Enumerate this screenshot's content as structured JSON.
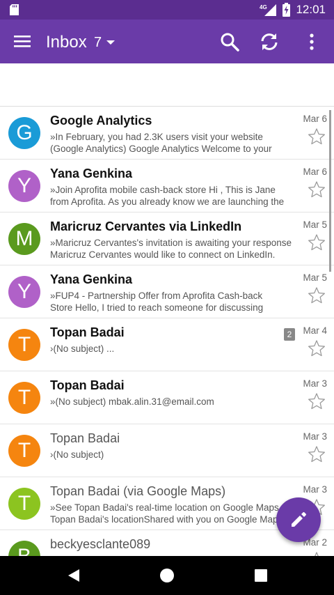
{
  "status_bar": {
    "network": "4G",
    "time": "12:01"
  },
  "app_bar": {
    "title": "Inbox",
    "unread_count": "7"
  },
  "emails": [
    {
      "sender": "Google Analytics",
      "bold": true,
      "initial": "G",
      "avatar_color": "#1a9bd7",
      "date": "Mar 6",
      "count": "",
      "line1": "»In February, you had 2.3K users visit your website",
      "line2": "(Google Analytics) Google Analytics Welcome to your"
    },
    {
      "sender": "Yana Genkina",
      "bold": true,
      "initial": "Y",
      "avatar_color": "#b061c8",
      "date": "Mar 6",
      "count": "",
      "line1": "»Join Aprofita mobile cash-back store Hi , This is Jane",
      "line2": "from Aprofita. As you already know we are launching the"
    },
    {
      "sender": "Maricruz Cervantes via LinkedIn",
      "bold": true,
      "initial": "M",
      "avatar_color": "#5a9a1e",
      "date": "Mar 5",
      "count": "",
      "line1": "»Maricruz Cervantes's invitation is awaiting your response",
      "line2": "Maricruz Cervantes would like to connect on LinkedIn."
    },
    {
      "sender": "Yana Genkina",
      "bold": true,
      "initial": "Y",
      "avatar_color": "#b061c8",
      "date": "Mar 5",
      "count": "",
      "line1": "»FUP4 - Partnership Offer from Aprofita Cash-back",
      "line2": "Store Hello, I tried to reach someone for discussing"
    },
    {
      "sender": "Topan Badai",
      "bold": true,
      "initial": "T",
      "avatar_color": "#f5850f",
      "date": "Mar 4",
      "count": "2",
      "line1": "›(No subject) ...",
      "line2": ""
    },
    {
      "sender": "Topan Badai",
      "bold": true,
      "initial": "T",
      "avatar_color": "#f5850f",
      "date": "Mar 3",
      "count": "",
      "line1": "»(No subject) mbak.alin.31@email.com",
      "line2": ""
    },
    {
      "sender": "Topan Badai",
      "bold": false,
      "initial": "T",
      "avatar_color": "#f5850f",
      "date": "Mar 3",
      "count": "",
      "line1": "›(No subject)",
      "line2": ""
    },
    {
      "sender": "Topan Badai (via Google Maps)",
      "bold": false,
      "initial": "T",
      "avatar_color": "#8cc420",
      "date": "Mar 3",
      "count": "",
      "line1": "»See Topan Badai's real-time location on Google Maps",
      "line2": "Topan Badai's locationShared with you on Google Maps"
    },
    {
      "sender": "beckyesclante089",
      "bold": false,
      "initial": "B",
      "avatar_color": "#5a9a1e",
      "date": "Mar 2",
      "count": "",
      "line1": "",
      "line2": ""
    }
  ],
  "colors": {
    "primary": "#6a3ba8",
    "status_bar": "#5b2d90"
  }
}
